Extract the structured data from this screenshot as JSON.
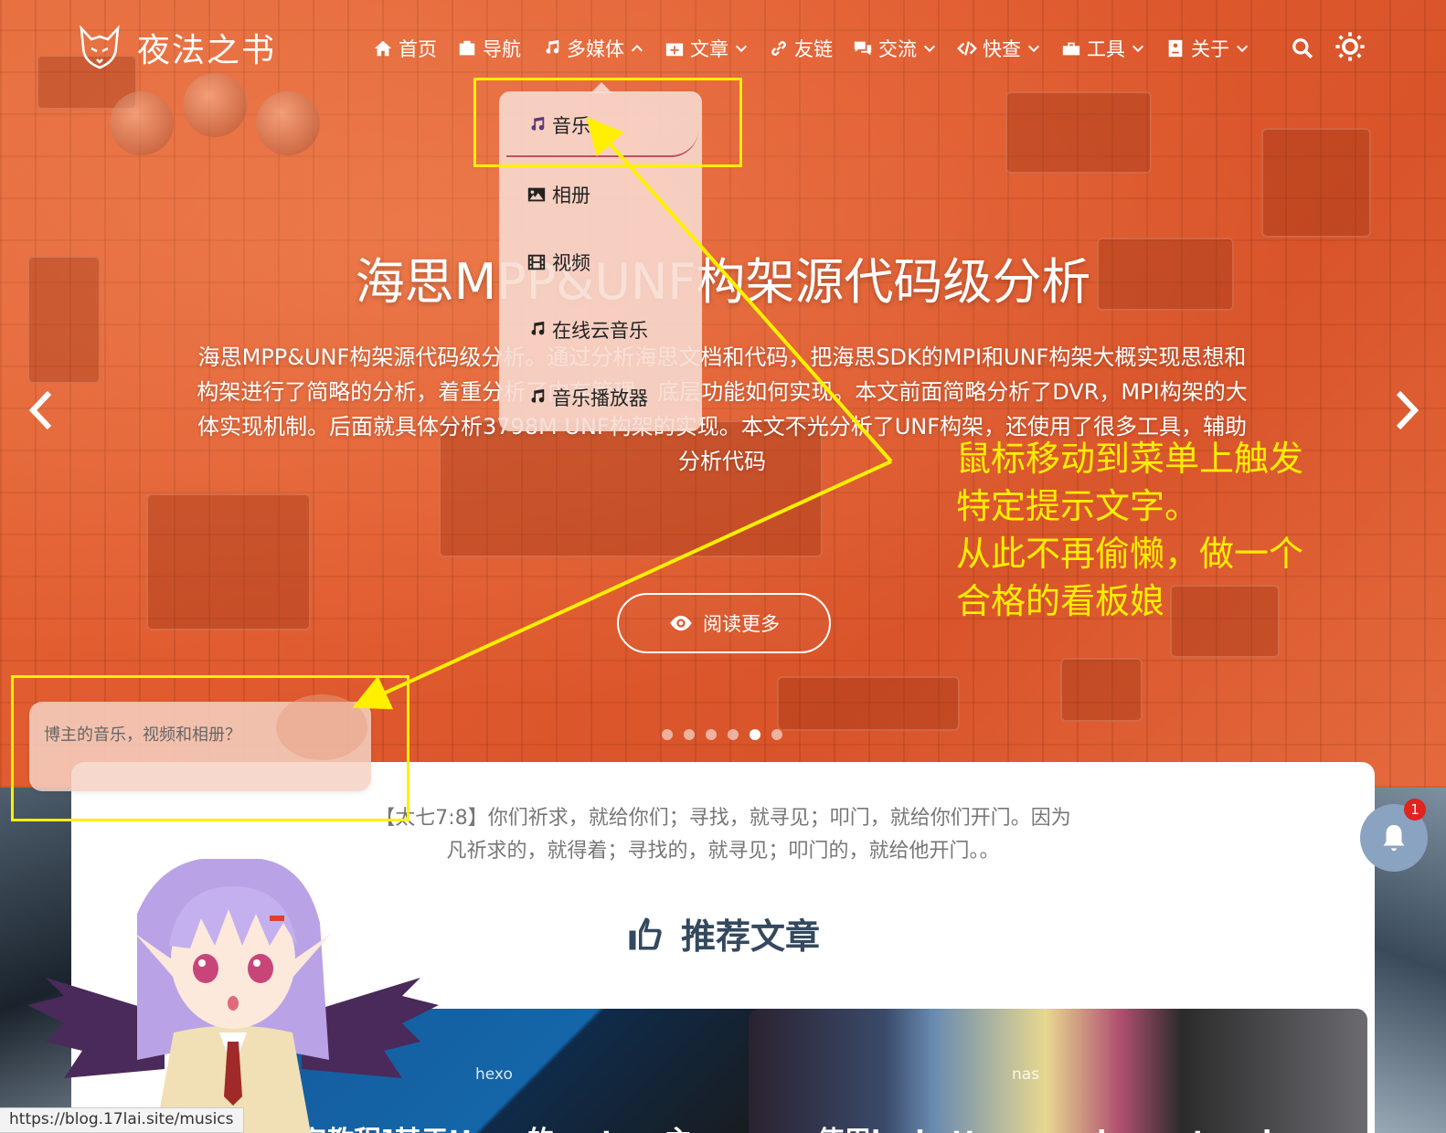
{
  "site": {
    "logo_text": "夜法之书"
  },
  "nav": {
    "items": [
      {
        "label": "首页",
        "icon": "home-icon",
        "caret": ""
      },
      {
        "label": "导航",
        "icon": "bookmark-icon",
        "caret": ""
      },
      {
        "label": "多媒体",
        "icon": "music-icon",
        "caret": "^"
      },
      {
        "label": "文章",
        "icon": "file-plus-icon",
        "caret": "v"
      },
      {
        "label": "友链",
        "icon": "link-icon",
        "caret": ""
      },
      {
        "label": "交流",
        "icon": "comments-icon",
        "caret": "v"
      },
      {
        "label": "快查",
        "icon": "code-icon",
        "caret": "v"
      },
      {
        "label": "工具",
        "icon": "toolbox-icon",
        "caret": "v"
      },
      {
        "label": "关于",
        "icon": "id-card-icon",
        "caret": "v"
      }
    ]
  },
  "dropdown": {
    "items": [
      {
        "label": "音乐",
        "icon": "music-icon"
      },
      {
        "label": "相册",
        "icon": "image-icon"
      },
      {
        "label": "视频",
        "icon": "film-icon"
      },
      {
        "label": "在线云音乐",
        "icon": "music-icon"
      },
      {
        "label": "音乐播放器",
        "icon": "music-icon"
      }
    ]
  },
  "slide": {
    "title": "海思MPP&UNF构架源代码级分析",
    "description": "海思MPP&UNF构架源代码级分析。通过分析海思文档和代码，把海思SDK的MPI和UNF构架大概实现思想和构架进行了简略的分析，着重分析了内存管理，底层功能如何实现。本文前面简略分析了DVR，MPI构架的大体实现机制。后面就具体分析3798M UNF构架的实现。本文不光分析了UNF构架，还使用了很多工具，辅助分析代码",
    "read_more": "阅读更多",
    "dot_count": 6,
    "active_dot": 5
  },
  "waifu_tip": "博主的音乐，视频和相册？",
  "annotation": {
    "line1": "鼠标移动到菜单上触发",
    "line2": "特定提示文字。",
    "line3": "从此不再偷懒，做一个",
    "line4": "合格的看板娘",
    "color": "#ffee00"
  },
  "content": {
    "verse_line1": "【太七7:8】你们祈求，就给你们；寻找，就寻见；叩门，就给你们开门。因为",
    "verse_line2": "凡祈求的，就得着；寻找的，就寻见；叩门的，就给他开门。。",
    "recommended_title": "推荐文章",
    "cards": [
      {
        "tag": "hexo",
        "title": "宇教程]基于Hexo的matery主"
      },
      {
        "tag": "nas",
        "title": "使用jeckett sonarr jyuu qt emby"
      }
    ]
  },
  "notification": {
    "badge": "1"
  },
  "status_url": "https://blog.17lai.site/musics",
  "colors": {
    "hero": "#e05a2e",
    "annotation": "#ffef00",
    "heading": "#34495e"
  }
}
